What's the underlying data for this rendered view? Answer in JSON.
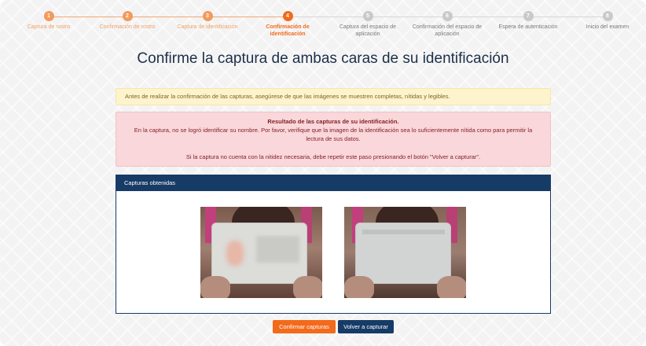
{
  "stepper": {
    "steps": [
      {
        "number": "1",
        "label": "Captura de rostro",
        "state": "done"
      },
      {
        "number": "2",
        "label": "Confirmación de rostro",
        "state": "done"
      },
      {
        "number": "3",
        "label": "Captura de identificación",
        "state": "done"
      },
      {
        "number": "4",
        "label": "Confirmación de identificación",
        "state": "active"
      },
      {
        "number": "5",
        "label": "Captura del espacio de aplicación",
        "state": "todo"
      },
      {
        "number": "6",
        "label": "Confirmación del espacio de aplicación",
        "state": "todo"
      },
      {
        "number": "7",
        "label": "Espera de autenticación",
        "state": "todo"
      },
      {
        "number": "8",
        "label": "Inicio del examen",
        "state": "todo"
      }
    ]
  },
  "title": "Confirme la captura de ambas caras de su identificación",
  "warning": "Antes de realizar la confirmación de las capturas, asegúrese de que las imágenes se muestren completas, nítidas y legibles.",
  "result": {
    "heading": "Resultado de las capturas de su identificación.",
    "message": "En la captura, no se logró identificar su nombre. Por favor, verifique que la imagen de la identificación sea lo suficientemente nítida como para permitir la lectura de sus datos.",
    "retry_hint": "Si la captura no cuenta con la nitidez necesaria, debe repetir este paso presionando el botón \"Volver a capturar\"."
  },
  "captures": {
    "header": "Capturas obtenidas",
    "images": [
      "id-front-photo",
      "id-back-photo"
    ]
  },
  "buttons": {
    "confirm": "Confirmar capturas",
    "retake": "Volver a capturar"
  },
  "colors": {
    "accent": "#f26a1b",
    "done": "#f39a5c",
    "pending": "#c9c9c9",
    "primary": "#163b66",
    "warning_bg": "#fdf3cd",
    "danger_bg": "#f9d7da"
  }
}
